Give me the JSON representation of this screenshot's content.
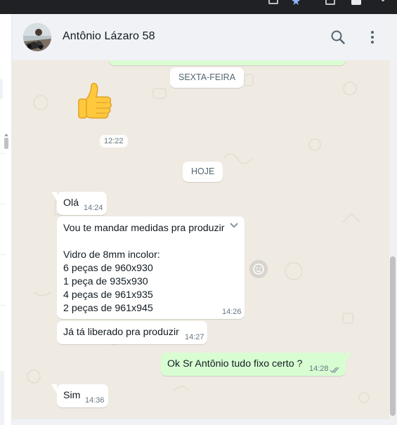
{
  "header": {
    "contact_name": "Antônio Lázaro 58"
  },
  "dates": {
    "friday": "SEXTA-FEIRA",
    "today": "HOJE"
  },
  "sticker": {
    "emoji": "👍",
    "time": "12:22"
  },
  "messages": [
    {
      "direction": "in",
      "text": "Olá",
      "time": "14:24"
    },
    {
      "direction": "in",
      "text": "Vou te mandar medidas pra produzir\n\nVidro de 8mm incolor:\n6 peças de 960x930\n1 peça de 935x930\n4 peças de 961x935\n2 peças de 961x945",
      "time": "14:26"
    },
    {
      "direction": "in",
      "text": "Já tá liberado pra produzir",
      "time": "14:27"
    },
    {
      "direction": "out",
      "text": "Ok Sr Antônio tudo fixo certo ?",
      "time": "14:28",
      "status": "read"
    },
    {
      "direction": "in",
      "text": "Sim",
      "time": "14:36"
    }
  ],
  "icons": {
    "search": "search-icon",
    "menu": "more-vertical-icon",
    "chevron": "chevron-down-icon",
    "react": "emoji-icon",
    "ticks": "double-check-icon"
  },
  "colors": {
    "incoming_bubble": "#ffffff",
    "outgoing_bubble": "#d9fdd3",
    "chat_background": "#efeae2",
    "header_background": "#f0f2f5",
    "read_ticks": "#8696a0"
  }
}
